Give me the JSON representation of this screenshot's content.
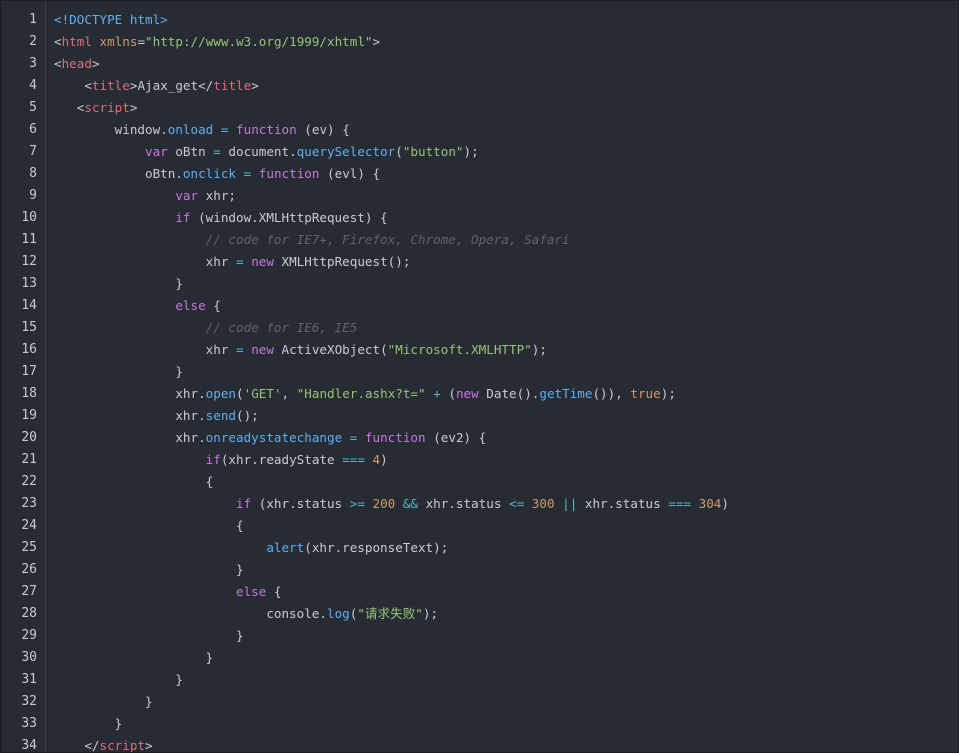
{
  "editor": {
    "lines": [
      {
        "num": "1",
        "indent": "",
        "tokens": [
          [
            "d",
            "<!DOCTYPE html>"
          ]
        ]
      },
      {
        "num": "2",
        "indent": "",
        "tokens": [
          [
            "p",
            "<"
          ],
          [
            "t",
            "html"
          ],
          [
            "p",
            " "
          ],
          [
            "a",
            "xmlns"
          ],
          [
            "p",
            "="
          ],
          [
            "s",
            "\"http://www.w3.org/1999/xhtml\""
          ],
          [
            "p",
            ">"
          ]
        ]
      },
      {
        "num": "3",
        "indent": "",
        "tokens": [
          [
            "p",
            "<"
          ],
          [
            "t",
            "head"
          ],
          [
            "p",
            ">"
          ]
        ]
      },
      {
        "num": "4",
        "indent": "    ",
        "tokens": [
          [
            "p",
            "<"
          ],
          [
            "t",
            "title"
          ],
          [
            "p",
            ">Ajax_get</"
          ],
          [
            "t",
            "title"
          ],
          [
            "p",
            ">"
          ]
        ]
      },
      {
        "num": "5",
        "indent": "   ",
        "tokens": [
          [
            "p",
            "<"
          ],
          [
            "t",
            "script"
          ],
          [
            "p",
            ">"
          ]
        ]
      },
      {
        "num": "6",
        "indent": "        ",
        "tokens": [
          [
            "p",
            "window."
          ],
          [
            "f",
            "onload"
          ],
          [
            "p",
            " "
          ],
          [
            "o",
            "="
          ],
          [
            "p",
            " "
          ],
          [
            "k",
            "function"
          ],
          [
            "p",
            " (ev) {"
          ]
        ]
      },
      {
        "num": "7",
        "indent": "            ",
        "tokens": [
          [
            "k",
            "var"
          ],
          [
            "p",
            " oBtn "
          ],
          [
            "o",
            "="
          ],
          [
            "p",
            " document."
          ],
          [
            "f",
            "querySelector"
          ],
          [
            "p",
            "("
          ],
          [
            "s",
            "\"button\""
          ],
          [
            "p",
            ");"
          ]
        ]
      },
      {
        "num": "8",
        "indent": "            ",
        "tokens": [
          [
            "p",
            "oBtn."
          ],
          [
            "f",
            "onclick"
          ],
          [
            "p",
            " "
          ],
          [
            "o",
            "="
          ],
          [
            "p",
            " "
          ],
          [
            "k",
            "function"
          ],
          [
            "p",
            " (evl) {"
          ]
        ]
      },
      {
        "num": "9",
        "indent": "                ",
        "tokens": [
          [
            "k",
            "var"
          ],
          [
            "p",
            " xhr;"
          ]
        ]
      },
      {
        "num": "10",
        "indent": "                ",
        "tokens": [
          [
            "k",
            "if"
          ],
          [
            "p",
            " (window.XMLHttpRequest) {"
          ]
        ]
      },
      {
        "num": "11",
        "indent": "                    ",
        "tokens": [
          [
            "c",
            "// code for IE7+, Firefox, Chrome, Opera, Safari"
          ]
        ]
      },
      {
        "num": "12",
        "indent": "                    ",
        "tokens": [
          [
            "p",
            "xhr "
          ],
          [
            "o",
            "="
          ],
          [
            "p",
            " "
          ],
          [
            "k",
            "new"
          ],
          [
            "p",
            " XMLHttpRequest();"
          ]
        ]
      },
      {
        "num": "13",
        "indent": "                ",
        "tokens": [
          [
            "p",
            "}"
          ]
        ]
      },
      {
        "num": "14",
        "indent": "                ",
        "tokens": [
          [
            "k",
            "else"
          ],
          [
            "p",
            " {"
          ]
        ]
      },
      {
        "num": "15",
        "indent": "                    ",
        "tokens": [
          [
            "c",
            "// code for IE6, IE5"
          ]
        ]
      },
      {
        "num": "16",
        "indent": "                    ",
        "tokens": [
          [
            "p",
            "xhr "
          ],
          [
            "o",
            "="
          ],
          [
            "p",
            " "
          ],
          [
            "k",
            "new"
          ],
          [
            "p",
            " ActiveXObject("
          ],
          [
            "s",
            "\"Microsoft.XMLHTTP\""
          ],
          [
            "p",
            ");"
          ]
        ]
      },
      {
        "num": "17",
        "indent": "                ",
        "tokens": [
          [
            "p",
            "}"
          ]
        ]
      },
      {
        "num": "18",
        "indent": "                ",
        "tokens": [
          [
            "p",
            "xhr."
          ],
          [
            "f",
            "open"
          ],
          [
            "p",
            "("
          ],
          [
            "s",
            "'GET'"
          ],
          [
            "p",
            ", "
          ],
          [
            "s",
            "\"Handler.ashx?t=\""
          ],
          [
            "p",
            " "
          ],
          [
            "o",
            "+"
          ],
          [
            "p",
            " ("
          ],
          [
            "k",
            "new"
          ],
          [
            "p",
            " Date()."
          ],
          [
            "f",
            "getTime"
          ],
          [
            "p",
            "()), "
          ],
          [
            "n",
            "true"
          ],
          [
            "p",
            ");"
          ]
        ]
      },
      {
        "num": "19",
        "indent": "                ",
        "tokens": [
          [
            "p",
            "xhr."
          ],
          [
            "f",
            "send"
          ],
          [
            "p",
            "();"
          ]
        ]
      },
      {
        "num": "20",
        "indent": "                ",
        "tokens": [
          [
            "p",
            "xhr."
          ],
          [
            "f",
            "onreadystatechange"
          ],
          [
            "p",
            " "
          ],
          [
            "o",
            "="
          ],
          [
            "p",
            " "
          ],
          [
            "k",
            "function"
          ],
          [
            "p",
            " (ev2) {"
          ]
        ]
      },
      {
        "num": "21",
        "indent": "                    ",
        "tokens": [
          [
            "k",
            "if"
          ],
          [
            "p",
            "(xhr.readyState "
          ],
          [
            "o",
            "==="
          ],
          [
            "p",
            " "
          ],
          [
            "n",
            "4"
          ],
          [
            "p",
            ")"
          ]
        ]
      },
      {
        "num": "22",
        "indent": "                    ",
        "tokens": [
          [
            "p",
            "{"
          ]
        ]
      },
      {
        "num": "23",
        "indent": "                        ",
        "tokens": [
          [
            "k",
            "if"
          ],
          [
            "p",
            " (xhr.status "
          ],
          [
            "o",
            ">="
          ],
          [
            "p",
            " "
          ],
          [
            "n",
            "200"
          ],
          [
            "p",
            " "
          ],
          [
            "o",
            "&&"
          ],
          [
            "p",
            " xhr.status "
          ],
          [
            "o",
            "<="
          ],
          [
            "p",
            " "
          ],
          [
            "n",
            "300"
          ],
          [
            "p",
            " "
          ],
          [
            "o",
            "||"
          ],
          [
            "p",
            " xhr.status "
          ],
          [
            "o",
            "==="
          ],
          [
            "p",
            " "
          ],
          [
            "n",
            "304"
          ],
          [
            "p",
            ")"
          ]
        ]
      },
      {
        "num": "24",
        "indent": "                        ",
        "tokens": [
          [
            "p",
            "{"
          ]
        ]
      },
      {
        "num": "25",
        "indent": "                            ",
        "tokens": [
          [
            "f",
            "alert"
          ],
          [
            "p",
            "(xhr.responseText);"
          ]
        ]
      },
      {
        "num": "26",
        "indent": "                        ",
        "tokens": [
          [
            "p",
            "}"
          ]
        ]
      },
      {
        "num": "27",
        "indent": "                        ",
        "tokens": [
          [
            "k",
            "else"
          ],
          [
            "p",
            " {"
          ]
        ]
      },
      {
        "num": "28",
        "indent": "                            ",
        "tokens": [
          [
            "p",
            "console."
          ],
          [
            "f",
            "log"
          ],
          [
            "p",
            "("
          ],
          [
            "s",
            "\"请求失败\""
          ],
          [
            "p",
            ");"
          ]
        ]
      },
      {
        "num": "29",
        "indent": "                        ",
        "tokens": [
          [
            "p",
            "}"
          ]
        ]
      },
      {
        "num": "30",
        "indent": "                    ",
        "tokens": [
          [
            "p",
            "}"
          ]
        ]
      },
      {
        "num": "31",
        "indent": "                ",
        "tokens": [
          [
            "p",
            "}"
          ]
        ]
      },
      {
        "num": "32",
        "indent": "            ",
        "tokens": [
          [
            "p",
            "}"
          ]
        ]
      },
      {
        "num": "33",
        "indent": "        ",
        "tokens": [
          [
            "p",
            "}"
          ]
        ]
      },
      {
        "num": "34",
        "indent": "    ",
        "tokens": [
          [
            "p",
            "</"
          ],
          [
            "t",
            "script"
          ],
          [
            "p",
            ">"
          ]
        ]
      }
    ]
  }
}
